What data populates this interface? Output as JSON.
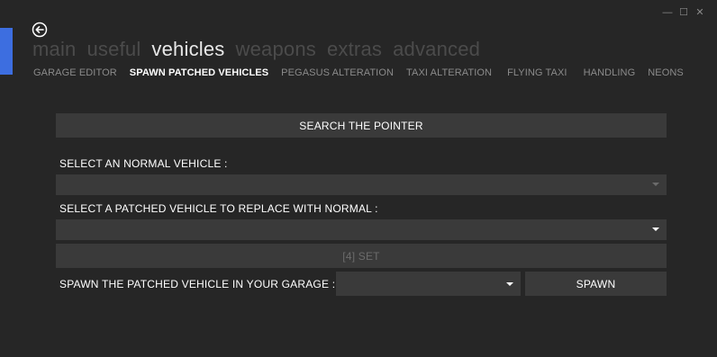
{
  "window_controls": {
    "minimize": "—",
    "maximize": "☐",
    "close": "✕"
  },
  "nav": {
    "main_tabs": [
      {
        "label": "main",
        "active": false
      },
      {
        "label": "useful",
        "active": false
      },
      {
        "label": "vehicles",
        "active": true
      },
      {
        "label": "weapons",
        "active": false
      },
      {
        "label": "extras",
        "active": false
      },
      {
        "label": "advanced",
        "active": false
      }
    ],
    "sub_tabs": [
      {
        "label": "GARAGE EDITOR",
        "active": false
      },
      {
        "label": "SPAWN PATCHED VEHICLES",
        "active": true
      },
      {
        "label": "PEGASUS ALTERATION",
        "active": false
      },
      {
        "label": "TAXI ALTERATION",
        "active": false
      },
      {
        "label": "FLYING TAXI",
        "active": false
      },
      {
        "label": "HANDLING",
        "active": false
      },
      {
        "label": "NEONS",
        "active": false
      }
    ]
  },
  "form": {
    "search_button": "SEARCH THE POINTER",
    "normal_vehicle_label": "SELECT AN NORMAL VEHICLE :",
    "normal_vehicle_value": "",
    "patched_vehicle_label": "SELECT A PATCHED VEHICLE TO REPLACE WITH NORMAL :",
    "patched_vehicle_value": "",
    "set_button": "[4] SET",
    "spawn_label": "SPAWN THE PATCHED VEHICLE IN YOUR GARAGE :",
    "garage_slot_value": "",
    "spawn_button": "SPAWN"
  },
  "colors": {
    "background": "#262626",
    "accent": "#3d6ee0",
    "control": "#3a3a3a",
    "inactive_tab": "#4b4b4b"
  }
}
